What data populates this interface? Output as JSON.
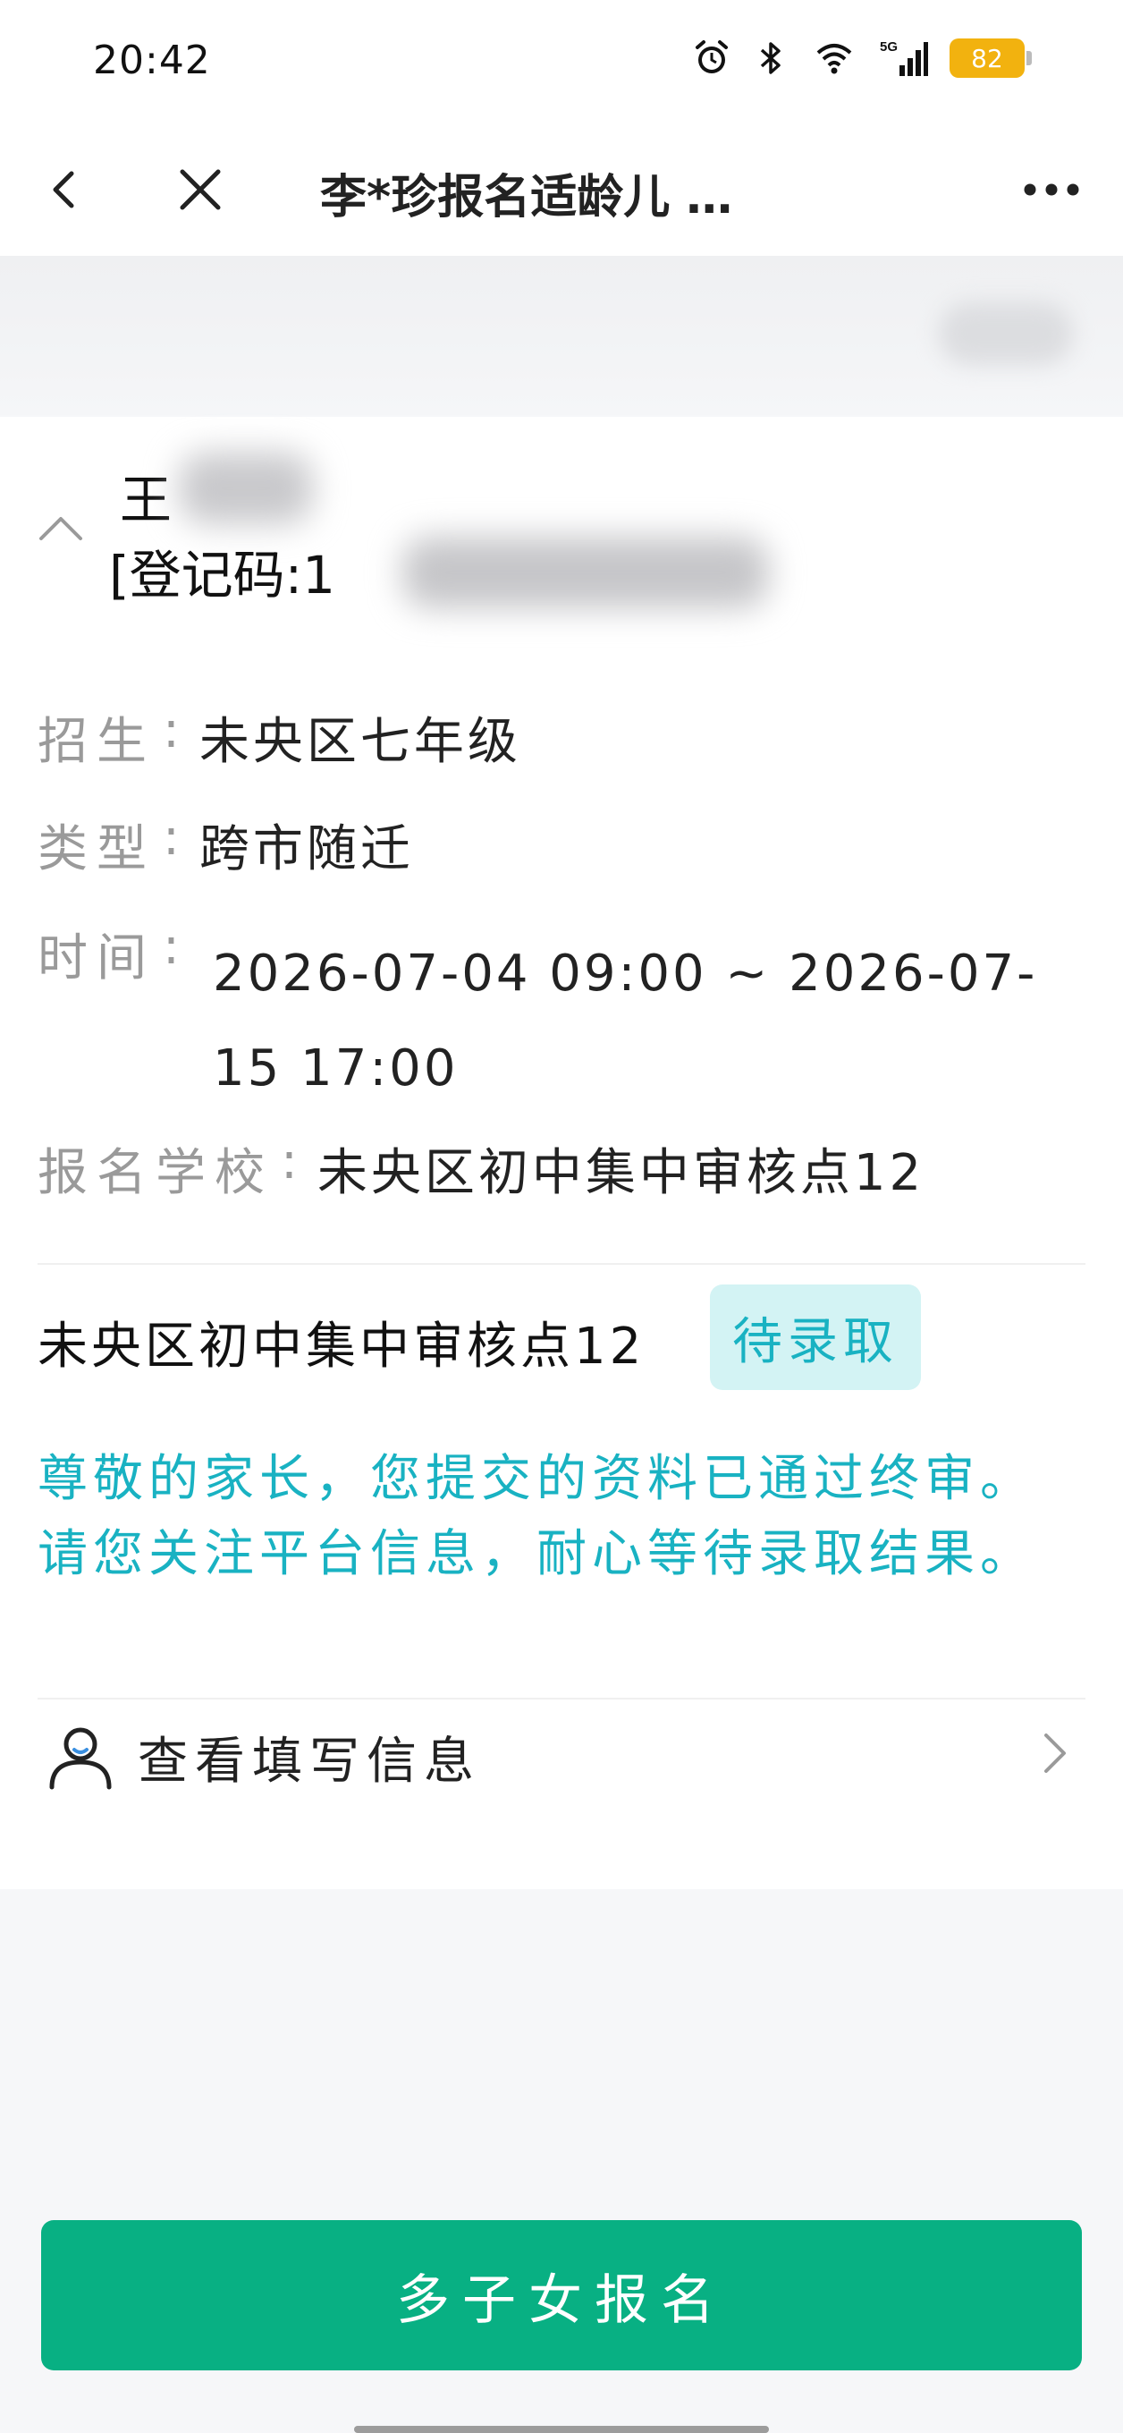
{
  "status_bar": {
    "time": "20:42",
    "icons": [
      "alarm-icon",
      "bluetooth-icon",
      "wifi-icon",
      "signal-5g-icon"
    ],
    "signal_label": "5G",
    "battery": "82",
    "battery_color": "#f2b20f"
  },
  "header": {
    "title": "李*珍报名适龄儿 …"
  },
  "applicant": {
    "name_prefix": "王",
    "reg_code_prefix": "[登记码:1"
  },
  "details": {
    "enroll_label": "招生",
    "enroll_value": "未央区七年级",
    "type_label": "类型",
    "type_value": "跨市随迁",
    "time_label": "时间",
    "time_value": "2026-07-04 09:00 ~ 2026-07-15 17:00",
    "school_label": "报名学校",
    "school_value": "未央区初中集中审核点12",
    "colon": ":"
  },
  "status": {
    "school": "未央区初中集中审核点12",
    "badge": "待录取",
    "notice": "尊敬的家长，您提交的资料已通过终审。请您关注平台信息，耐心等待录取结果。",
    "accent_color": "#19b2c2"
  },
  "actions": {
    "view_info": "查看填写信息",
    "multi_child": "多子女报名",
    "button_color": "#08b083"
  }
}
